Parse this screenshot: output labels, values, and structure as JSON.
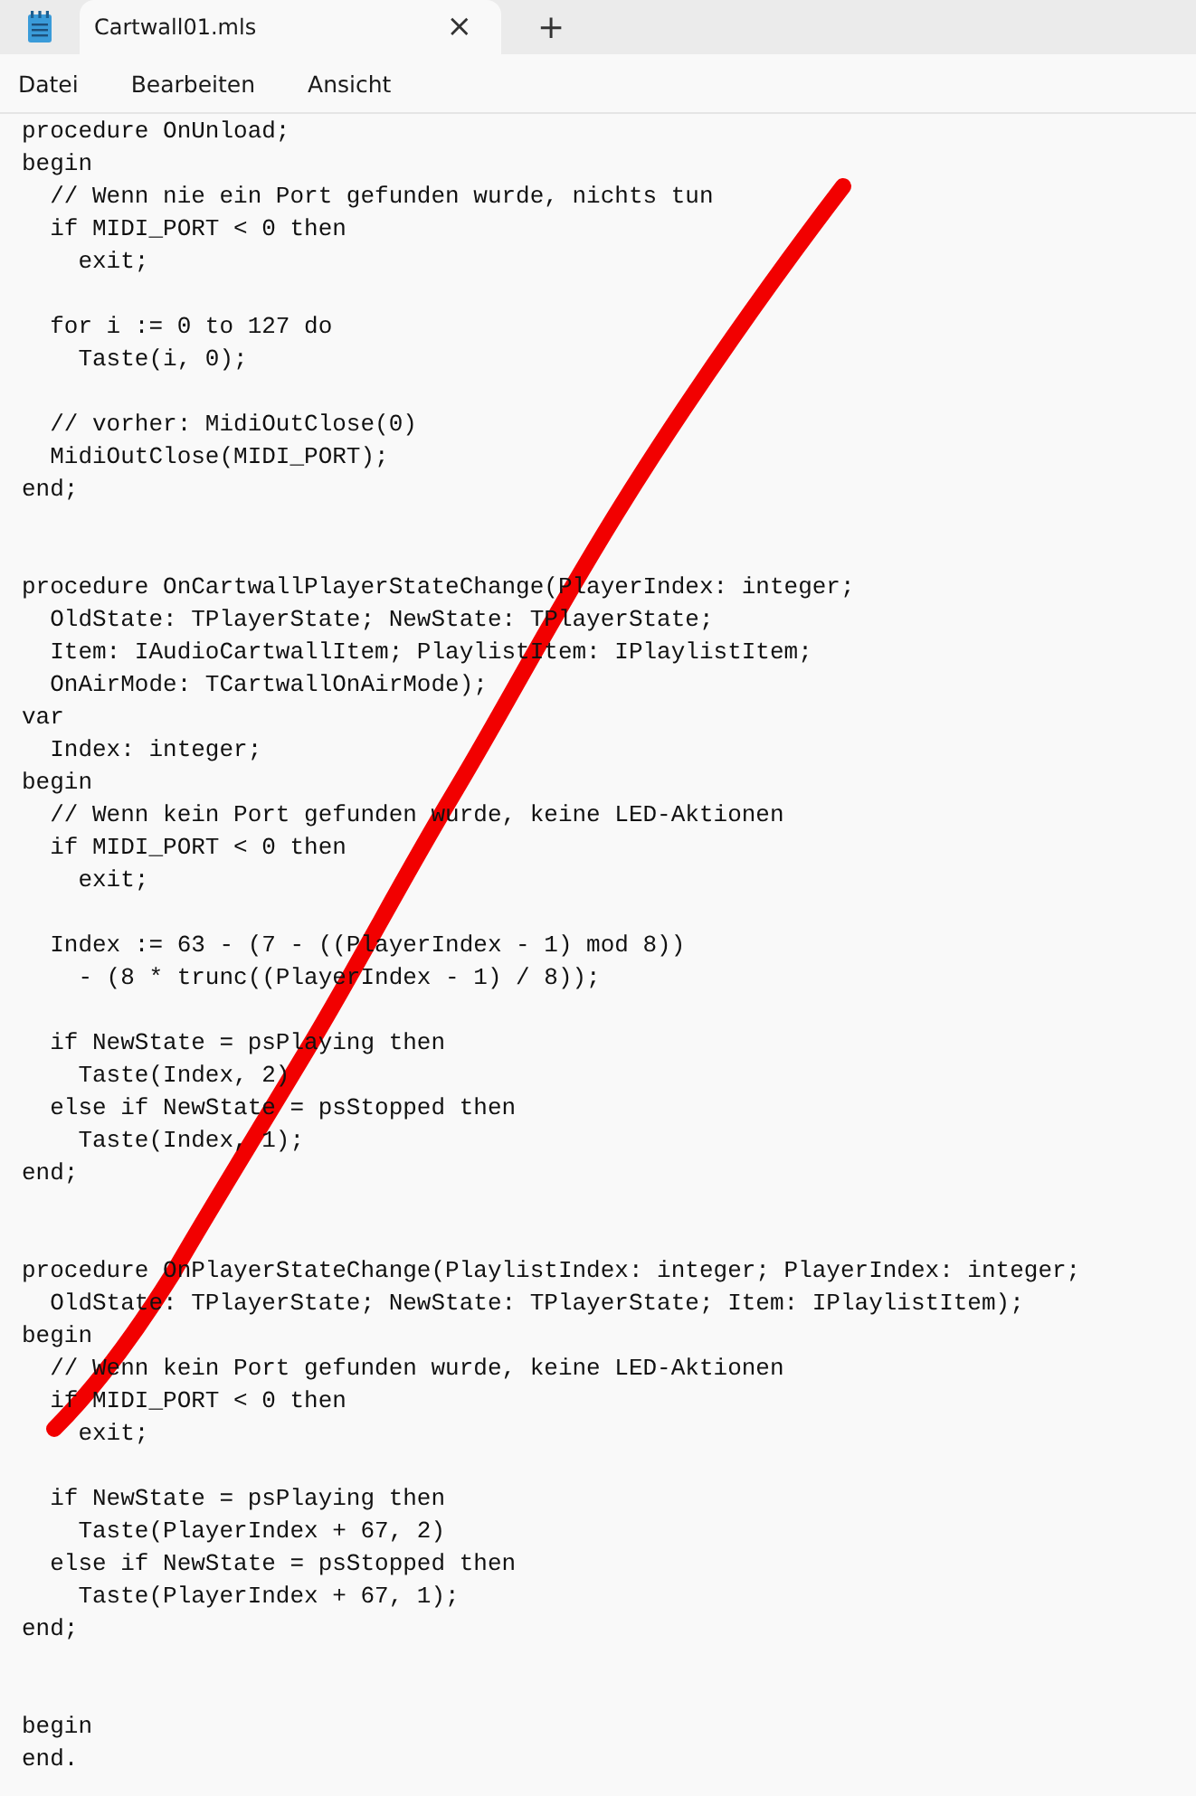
{
  "tabs": [
    {
      "title": "Cartwall01.mls",
      "selected": true,
      "close": "×"
    }
  ],
  "new_tab": "+",
  "menu": [
    "Datei",
    "Bearbeiten",
    "Ansicht"
  ],
  "lines": [
    {
      "kind": "code",
      "text": "procedure OnUnload;"
    },
    {
      "kind": "code",
      "text": "begin"
    },
    {
      "kind": "code",
      "text": "  // Wenn nie ein Port gefunden wurde, nichts tun"
    },
    {
      "kind": "code",
      "text": "  if MIDI_PORT < 0 then"
    },
    {
      "kind": "code",
      "text": "    exit;"
    },
    {
      "kind": "blank"
    },
    {
      "kind": "code",
      "text": "  for i := 0 to 127 do"
    },
    {
      "kind": "code",
      "text": "    Taste(i, 0);"
    },
    {
      "kind": "blank"
    },
    {
      "kind": "code",
      "text": "  // vorher: MidiOutClose(0)"
    },
    {
      "kind": "code",
      "text": "  MidiOutClose(MIDI_PORT);"
    },
    {
      "kind": "code",
      "text": "end;"
    },
    {
      "kind": "blank"
    },
    {
      "kind": "blank"
    },
    {
      "kind": "code",
      "text": "procedure OnCartwallPlayerStateChange(PlayerIndex: integer;"
    },
    {
      "kind": "code",
      "text": "  OldState: TPlayerState; NewState: TPlayerState;"
    },
    {
      "kind": "code",
      "text": "  Item: IAudioCartwallItem; PlaylistItem: IPlaylistItem;"
    },
    {
      "kind": "code",
      "text": "  OnAirMode: TCartwallOnAirMode);"
    },
    {
      "kind": "code",
      "text": "var"
    },
    {
      "kind": "code",
      "text": "  Index: integer;"
    },
    {
      "kind": "code",
      "text": "begin"
    },
    {
      "kind": "code",
      "text": "  // Wenn kein Port gefunden wurde, keine LED-Aktionen"
    },
    {
      "kind": "code",
      "text": "  if MIDI_PORT < 0 then"
    },
    {
      "kind": "code",
      "text": "    exit;"
    },
    {
      "kind": "blank"
    },
    {
      "kind": "code",
      "text": "  Index := 63 - (7 - ((PlayerIndex - 1) mod 8))"
    },
    {
      "kind": "code",
      "text": "    - (8 * trunc((PlayerIndex - 1) / 8));"
    },
    {
      "kind": "blank"
    },
    {
      "kind": "code",
      "text": "  if NewState = psPlaying then"
    },
    {
      "kind": "code",
      "text": "    Taste(Index, 2)"
    },
    {
      "kind": "code",
      "text": "  else if NewState = psStopped then"
    },
    {
      "kind": "code",
      "text": "    Taste(Index, 1);"
    },
    {
      "kind": "code",
      "text": "end;"
    },
    {
      "kind": "blank"
    },
    {
      "kind": "blank"
    },
    {
      "kind": "code",
      "text": "procedure OnPlayerStateChange(PlaylistIndex: integer; PlayerIndex: integer;"
    },
    {
      "kind": "code",
      "text": "  OldState: TPlayerState; NewState: TPlayerState; Item: IPlaylistItem);"
    },
    {
      "kind": "code",
      "text": "begin"
    },
    {
      "kind": "code",
      "text": "  // Wenn kein Port gefunden wurde, keine LED-Aktionen"
    },
    {
      "kind": "code",
      "text": "  if MIDI_PORT < 0 then"
    },
    {
      "kind": "code",
      "text": "    exit;"
    },
    {
      "kind": "blank"
    },
    {
      "kind": "code",
      "text": "  if NewState = psPlaying then"
    },
    {
      "kind": "code",
      "text": "    Taste(PlayerIndex + 67, 2)"
    },
    {
      "kind": "code",
      "text": "  else if NewState = psStopped then"
    },
    {
      "kind": "code",
      "text": "    Taste(PlayerIndex + 67, 1);"
    },
    {
      "kind": "code",
      "text": "end;"
    },
    {
      "kind": "blank"
    },
    {
      "kind": "blank"
    },
    {
      "kind": "code",
      "text": "begin"
    },
    {
      "kind": "code",
      "text": "end."
    }
  ]
}
